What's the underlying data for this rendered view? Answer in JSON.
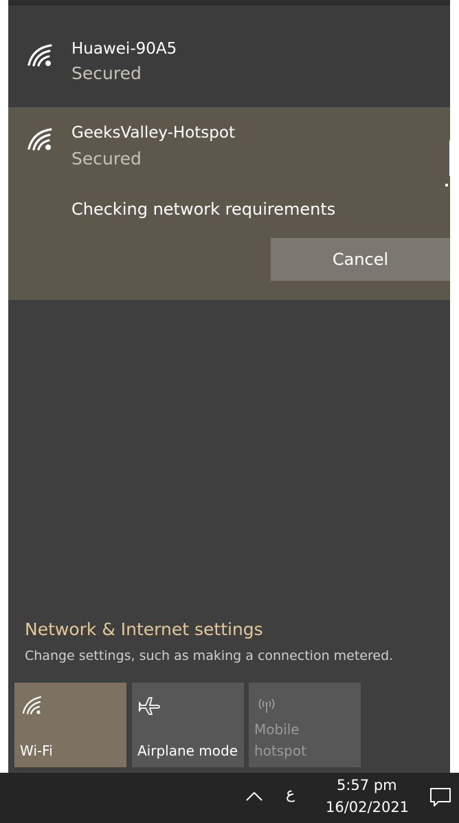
{
  "networks": [
    {
      "name": "Huawei-90A5",
      "status": "Secured",
      "icon": "wifi-secured-icon"
    },
    {
      "name": "GeeksValley-Hotspot",
      "status": "Secured",
      "icon": "wifi-secured-icon",
      "message": "Checking network requirements",
      "cancel_label": "Cancel"
    }
  ],
  "settings": {
    "link_label": "Network & Internet settings",
    "description": "Change settings, such as making a connection metered."
  },
  "quick_actions": [
    {
      "label": "Wi-Fi",
      "icon": "wifi-icon",
      "active": true
    },
    {
      "label": "Airplane mode",
      "icon": "airplane-icon",
      "active": false
    },
    {
      "label": "Mobile hotspot",
      "label_line1": "Mobile",
      "label_line2": "hotspot",
      "icon": "mobile-hotspot-icon",
      "active": false,
      "disabled": true
    }
  ],
  "taskbar": {
    "ime": "ع",
    "time": "5:57 pm",
    "date": "16/02/2021"
  },
  "colors": {
    "flyout_bg": "#3f3f3f",
    "selected_network_bg": "#5e574b",
    "accent_tile": "#7d7261",
    "settings_link": "#e2c89a",
    "taskbar_bg": "#252525"
  }
}
